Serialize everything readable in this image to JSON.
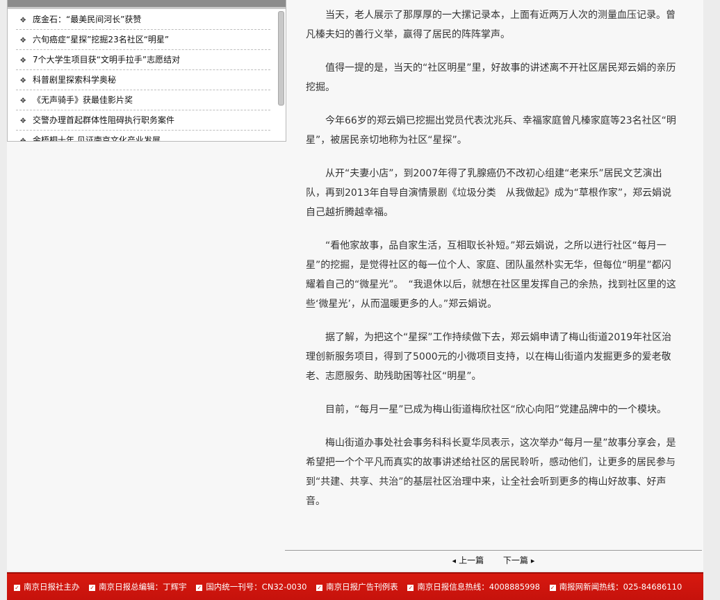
{
  "sidebar": {
    "news": [
      "庞金石：“最美民间河长”获赞",
      "六旬癌症“星探”挖掘23名社区“明星”",
      "7个大学生项目获“文明手拉手”志愿结对",
      "科普剧里探索科学奥秘",
      "《无声骑手》获最佳影片奖",
      "交警办理首起群体性阻碍执行职务案件",
      "金梧桐十年 见证南京文化产业发展"
    ]
  },
  "article": {
    "paragraphs": [
      "当天，老人展示了那厚厚的一大摞记录本，上面有近两万人次的测量血压记录。曾凡榛夫妇的善行义举，赢得了居民的阵阵掌声。",
      "值得一提的是，当天的“社区明星”里，好故事的讲述离不开社区居民郑云娟的亲历挖掘。",
      "今年66岁的郑云娟已挖掘出党员代表沈兆兵、幸福家庭曾凡榛家庭等23名社区“明星”，被居民亲切地称为社区“星探”。",
      "从开“夫妻小店”，到2007年得了乳腺癌仍不改初心组建“老来乐”居民文艺演出队，再到2013年自导自演情景剧《垃圾分类　从我做起》成为“草根作家”，郑云娟说自己越折腾越幸福。",
      "“看他家故事，品自家生活，互相取长补短。”郑云娟说，之所以进行社区“每月一星”的挖掘，是觉得社区的每一位个人、家庭、团队虽然朴实无华，但每位“明星”都闪耀着自己的“微星光”。　“我退休以后，就想在社区里发挥自己的余热，找到社区里的这些‘微星光’，从而温暖更多的人。”郑云娟说。",
      "据了解，为把这个“星探”工作持续做下去，郑云娟申请了梅山街道2019年社区治理创新服务项目，得到了5000元的小微项目支持，以在梅山街道内发掘更多的爱老敬老、志愿服务、助残助困等社区“明星”。",
      "目前，“每月一星”已成为梅山街道梅欣社区“欣心向阳”党建品牌中的一个模块。",
      "梅山街道办事处社会事务科科长夏华凤表示，这次举办“每月一星”故事分享会，是希望把一个个平凡而真实的故事讲述给社区的居民聆听，感动他们，让更多的居民参与到“共建、共享、共治”的基层社区治理中来，让全社会听到更多的梅山好故事、好声音。"
    ]
  },
  "pager": {
    "prev": "上一篇",
    "next": "下一篇"
  },
  "footer": {
    "items": [
      "南京日报社主办",
      "南京日报总编辑：丁辉宇",
      "国内统一刊号：CN32-0030",
      "南京日报广告刊例表",
      "南京日报信息热线：4008885998",
      "南报网新闻热线：025-84686110"
    ]
  },
  "colors": {
    "footer_red": "#c6120c",
    "page_bg": "#f7f7f7"
  }
}
